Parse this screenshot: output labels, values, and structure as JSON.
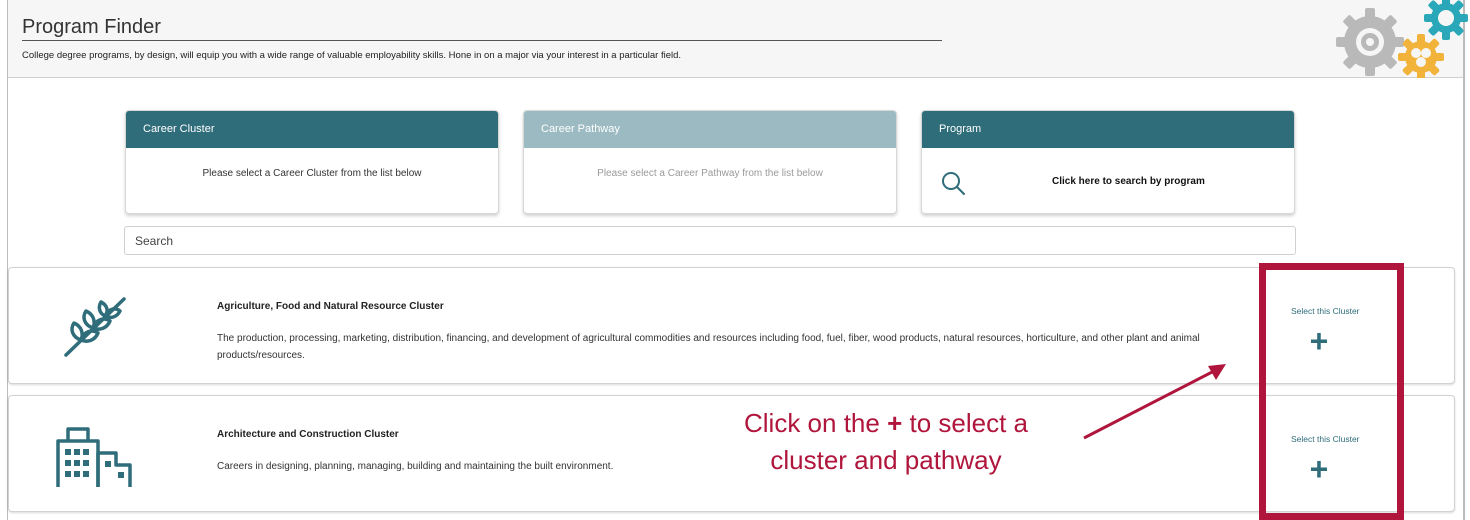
{
  "header": {
    "title": "Program Finder",
    "subtitle": "College degree programs, by design, will equip you with a wide range of valuable employability skills. Hone in on a major via your interest in a particular field."
  },
  "selectors": [
    {
      "heading": "Career Cluster",
      "text": "Please select a Career Cluster from the list below"
    },
    {
      "heading": "Career Pathway",
      "text": "Please select a Career Pathway from the list below"
    },
    {
      "heading": "Program",
      "text": "Click here to search by program"
    }
  ],
  "search": {
    "value": "Search"
  },
  "clusters": [
    {
      "title": "Agriculture, Food and Natural Resource Cluster",
      "description": "The production, processing, marketing, distribution, financing, and development of agricultural commodities and resources including food, fuel, fiber, wood products, natural resources, horticulture, and other plant and animal products/resources.",
      "select_label": "Select this Cluster",
      "action": "+",
      "icon": "wheat-icon"
    },
    {
      "title": "Architecture and Construction Cluster",
      "description": "Careers in designing, planning, managing, building and maintaining the built environment.",
      "select_label": "Select this Cluster",
      "action": "+",
      "icon": "buildings-icon"
    }
  ],
  "annotation": {
    "line1_prefix": "Click on the ",
    "line1_bold": "+",
    "line1_suffix": " to select a",
    "line2": "cluster and pathway"
  },
  "colors": {
    "accent": "#2f6d7a",
    "accent_muted": "#9cbac2",
    "annotation": "#b0163c"
  }
}
